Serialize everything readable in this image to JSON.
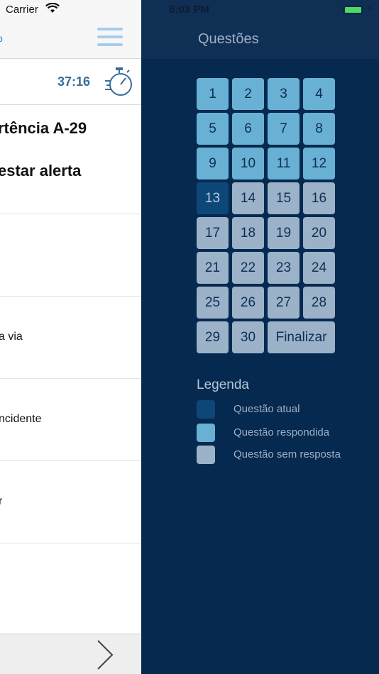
{
  "status_bar": {
    "carrier": "Carrier",
    "time": "5:03 PM"
  },
  "main": {
    "nav_partial_text": "o",
    "timer": "37:16",
    "question_line1": "rtência A-29",
    "question_line2": "estar alerta",
    "options": [
      "",
      "a via",
      "ncidente",
      "r",
      ""
    ]
  },
  "drawer": {
    "title": "Questões",
    "questions": [
      {
        "label": "1",
        "state": "answered"
      },
      {
        "label": "2",
        "state": "answered"
      },
      {
        "label": "3",
        "state": "answered"
      },
      {
        "label": "4",
        "state": "answered"
      },
      {
        "label": "5",
        "state": "answered"
      },
      {
        "label": "6",
        "state": "answered"
      },
      {
        "label": "7",
        "state": "answered"
      },
      {
        "label": "8",
        "state": "answered"
      },
      {
        "label": "9",
        "state": "answered"
      },
      {
        "label": "10",
        "state": "answered"
      },
      {
        "label": "11",
        "state": "answered"
      },
      {
        "label": "12",
        "state": "answered"
      },
      {
        "label": "13",
        "state": "current"
      },
      {
        "label": "14",
        "state": "unanswered"
      },
      {
        "label": "15",
        "state": "unanswered"
      },
      {
        "label": "16",
        "state": "unanswered"
      },
      {
        "label": "17",
        "state": "unanswered"
      },
      {
        "label": "18",
        "state": "unanswered"
      },
      {
        "label": "19",
        "state": "unanswered"
      },
      {
        "label": "20",
        "state": "unanswered"
      },
      {
        "label": "21",
        "state": "unanswered"
      },
      {
        "label": "22",
        "state": "unanswered"
      },
      {
        "label": "23",
        "state": "unanswered"
      },
      {
        "label": "24",
        "state": "unanswered"
      },
      {
        "label": "25",
        "state": "unanswered"
      },
      {
        "label": "26",
        "state": "unanswered"
      },
      {
        "label": "27",
        "state": "unanswered"
      },
      {
        "label": "28",
        "state": "unanswered"
      },
      {
        "label": "29",
        "state": "unanswered"
      },
      {
        "label": "30",
        "state": "unanswered"
      }
    ],
    "finalize_label": "Finalizar",
    "legend": {
      "title": "Legenda",
      "current": "Questão atual",
      "answered": "Questão respondida",
      "unanswered": "Questão sem resposta"
    }
  },
  "colors": {
    "current": "#0d4778",
    "answered": "#68b1d4",
    "unanswered": "#9bb2c9",
    "drawer_bg": "#06294f"
  }
}
